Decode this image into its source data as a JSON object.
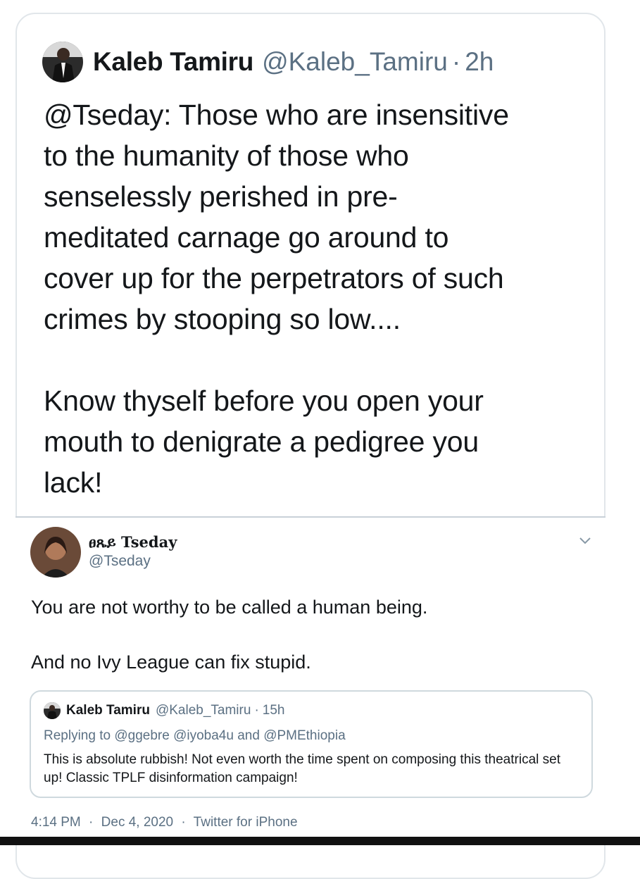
{
  "main_tweet": {
    "author_name": "Kaleb Tamiru",
    "handle": "@Kaleb_Tamiru",
    "separator": "·",
    "time": "2h",
    "paragraph1": "@Tseday:   Those who are insensitive\nto the humanity of those who\nsenselessly perished in pre-\nmeditated carnage go around to\ncover up for the perpetrators of such\ncrimes by stooping so low....",
    "paragraph2": "Know thyself before you open your\nmouth to denigrate a pedigree you\nlack!"
  },
  "quoted_reply": {
    "author_name": "ፀጼይ Tseday",
    "handle": "@Tseday",
    "line1": "You are not worthy to be called a human being.",
    "line2": "And no Ivy League can fix stupid.",
    "meta": {
      "time": "4:14 PM",
      "sep1": "·",
      "date": "Dec 4, 2020",
      "sep2": "·",
      "source": "Twitter for iPhone"
    }
  },
  "nested_quote": {
    "author_name": "Kaleb Tamiru",
    "handle": "@Kaleb_Tamiru",
    "separator": "·",
    "time": "15h",
    "replying_label": "Replying to",
    "mentions": [
      "@ggebre",
      "@iyoba4u",
      "and",
      "@PMEthiopia"
    ],
    "text": "This is absolute rubbish!  Not even worth the time spent on composing this theatrical set up!  Classic TPLF disinformation campaign!"
  },
  "icons": {
    "avatar_top": "avatar-man-suit",
    "avatar_inner": "avatar-woman",
    "chevron": "chevron-down-icon"
  },
  "colors": {
    "text": "#14171a",
    "secondary": "#5b7083",
    "border": "#cfd9de"
  }
}
